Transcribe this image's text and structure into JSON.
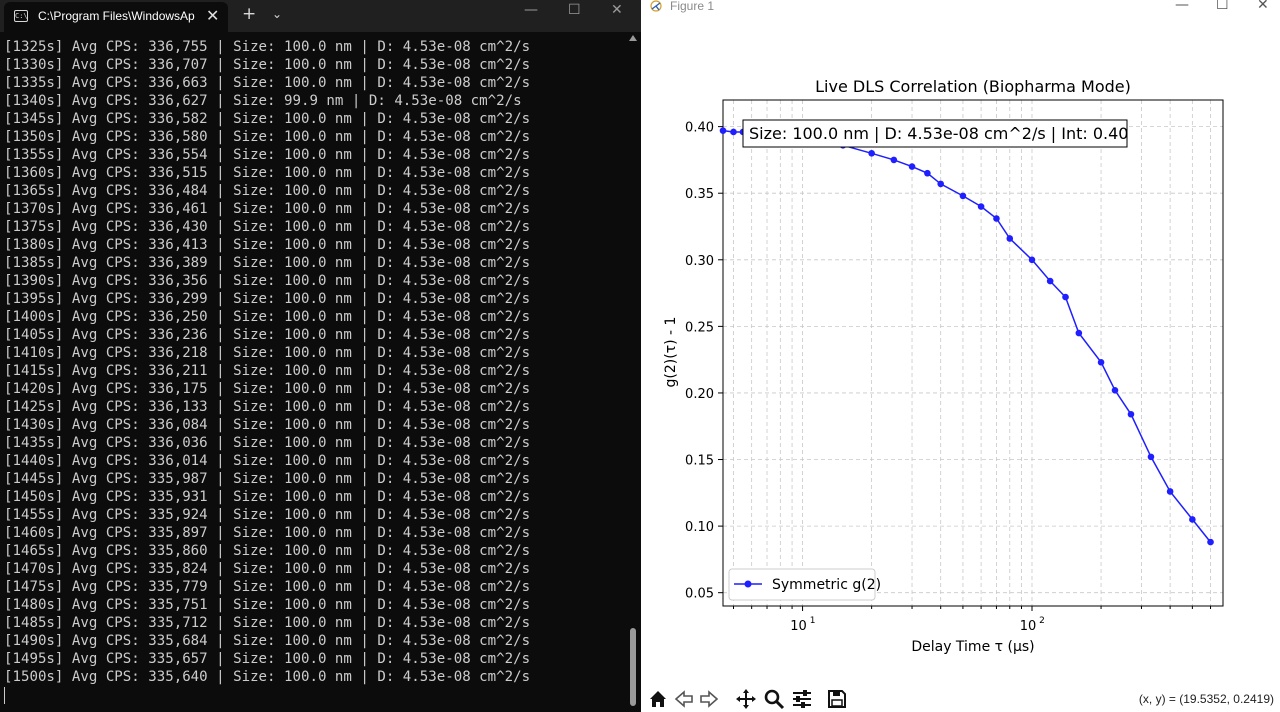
{
  "terminal": {
    "tab_title": "C:\\Program Files\\WindowsAp",
    "tab_icon_text": "C:\\",
    "lines": [
      "[1325s] Avg CPS: 336,755 | Size: 100.0 nm | D: 4.53e-08 cm^2/s",
      "[1330s] Avg CPS: 336,707 | Size: 100.0 nm | D: 4.53e-08 cm^2/s",
      "[1335s] Avg CPS: 336,663 | Size: 100.0 nm | D: 4.53e-08 cm^2/s",
      "[1340s] Avg CPS: 336,627 | Size: 99.9 nm | D: 4.53e-08 cm^2/s",
      "[1345s] Avg CPS: 336,582 | Size: 100.0 nm | D: 4.53e-08 cm^2/s",
      "[1350s] Avg CPS: 336,580 | Size: 100.0 nm | D: 4.53e-08 cm^2/s",
      "[1355s] Avg CPS: 336,554 | Size: 100.0 nm | D: 4.53e-08 cm^2/s",
      "[1360s] Avg CPS: 336,515 | Size: 100.0 nm | D: 4.53e-08 cm^2/s",
      "[1365s] Avg CPS: 336,484 | Size: 100.0 nm | D: 4.53e-08 cm^2/s",
      "[1370s] Avg CPS: 336,461 | Size: 100.0 nm | D: 4.53e-08 cm^2/s",
      "[1375s] Avg CPS: 336,430 | Size: 100.0 nm | D: 4.53e-08 cm^2/s",
      "[1380s] Avg CPS: 336,413 | Size: 100.0 nm | D: 4.53e-08 cm^2/s",
      "[1385s] Avg CPS: 336,389 | Size: 100.0 nm | D: 4.53e-08 cm^2/s",
      "[1390s] Avg CPS: 336,356 | Size: 100.0 nm | D: 4.53e-08 cm^2/s",
      "[1395s] Avg CPS: 336,299 | Size: 100.0 nm | D: 4.53e-08 cm^2/s",
      "[1400s] Avg CPS: 336,250 | Size: 100.0 nm | D: 4.53e-08 cm^2/s",
      "[1405s] Avg CPS: 336,236 | Size: 100.0 nm | D: 4.53e-08 cm^2/s",
      "[1410s] Avg CPS: 336,218 | Size: 100.0 nm | D: 4.53e-08 cm^2/s",
      "[1415s] Avg CPS: 336,211 | Size: 100.0 nm | D: 4.53e-08 cm^2/s",
      "[1420s] Avg CPS: 336,175 | Size: 100.0 nm | D: 4.53e-08 cm^2/s",
      "[1425s] Avg CPS: 336,133 | Size: 100.0 nm | D: 4.53e-08 cm^2/s",
      "[1430s] Avg CPS: 336,084 | Size: 100.0 nm | D: 4.53e-08 cm^2/s",
      "[1435s] Avg CPS: 336,036 | Size: 100.0 nm | D: 4.53e-08 cm^2/s",
      "[1440s] Avg CPS: 336,014 | Size: 100.0 nm | D: 4.53e-08 cm^2/s",
      "[1445s] Avg CPS: 335,987 | Size: 100.0 nm | D: 4.53e-08 cm^2/s",
      "[1450s] Avg CPS: 335,931 | Size: 100.0 nm | D: 4.53e-08 cm^2/s",
      "[1455s] Avg CPS: 335,924 | Size: 100.0 nm | D: 4.53e-08 cm^2/s",
      "[1460s] Avg CPS: 335,897 | Size: 100.0 nm | D: 4.53e-08 cm^2/s",
      "[1465s] Avg CPS: 335,860 | Size: 100.0 nm | D: 4.53e-08 cm^2/s",
      "[1470s] Avg CPS: 335,824 | Size: 100.0 nm | D: 4.53e-08 cm^2/s",
      "[1475s] Avg CPS: 335,779 | Size: 100.0 nm | D: 4.53e-08 cm^2/s",
      "[1480s] Avg CPS: 335,751 | Size: 100.0 nm | D: 4.53e-08 cm^2/s",
      "[1485s] Avg CPS: 335,712 | Size: 100.0 nm | D: 4.53e-08 cm^2/s",
      "[1490s] Avg CPS: 335,684 | Size: 100.0 nm | D: 4.53e-08 cm^2/s",
      "[1495s] Avg CPS: 335,657 | Size: 100.0 nm | D: 4.53e-08 cm^2/s",
      "[1500s] Avg CPS: 335,640 | Size: 100.0 nm | D: 4.53e-08 cm^2/s"
    ],
    "controls": {
      "close_tab": "✕",
      "new_tab": "+",
      "dropdown": "⌄",
      "minimize": "—",
      "maximize": "☐",
      "close": "✕"
    },
    "colors": {
      "background": "#0c0c0c",
      "text": "#cccccc",
      "titlebar": "#202020"
    }
  },
  "figure": {
    "window_title": "Figure 1",
    "controls": {
      "minimize": "—",
      "maximize": "☐",
      "close": "✕"
    },
    "toolbar": {
      "buttons": [
        "home-icon",
        "back-icon",
        "forward-icon",
        "pan-icon",
        "zoom-icon",
        "configure-subplots-icon",
        "save-icon"
      ],
      "coords_text": "(x, y) = (19.5352, 0.2419)"
    }
  },
  "chart_data": {
    "type": "line",
    "title": "Live DLS Correlation (Biopharma Mode)",
    "xlabel_text": "Delay Time τ (μs)",
    "ylabel_text": "g(2)(τ) - 1",
    "xscale": "log",
    "xlim": [
      4.5,
      680
    ],
    "ylim": [
      0.04,
      0.42
    ],
    "xticks": [
      {
        "base": "10",
        "exp": "1",
        "value": 10
      },
      {
        "base": "10",
        "exp": "2",
        "value": 100
      }
    ],
    "yticks": [
      0.05,
      0.1,
      0.15,
      0.2,
      0.25,
      0.3,
      0.35,
      0.4
    ],
    "ytick_labels": [
      "0.05",
      "0.10",
      "0.15",
      "0.20",
      "0.25",
      "0.30",
      "0.35",
      "0.40"
    ],
    "grid": true,
    "annotation": "Size: 100.0 nm | D: 4.53e-08 cm^2/s | Int: 0.40",
    "legend": {
      "label": "Symmetric g(2)",
      "position": "lower-left"
    },
    "series": [
      {
        "name": "Symmetric g(2)",
        "color": "#1f1fff",
        "points": [
          [
            4.5,
            0.397
          ],
          [
            5.0,
            0.396
          ],
          [
            5.5,
            0.396
          ],
          [
            6.0,
            0.396
          ],
          [
            6.5,
            0.395
          ],
          [
            7.0,
            0.395
          ],
          [
            7.5,
            0.394
          ],
          [
            8.0,
            0.394
          ],
          [
            10.0,
            0.392
          ],
          [
            12.5,
            0.389
          ],
          [
            15.0,
            0.386
          ],
          [
            20.0,
            0.38
          ],
          [
            25.0,
            0.375
          ],
          [
            30.0,
            0.37
          ],
          [
            35.0,
            0.365
          ],
          [
            40.0,
            0.357
          ],
          [
            50.0,
            0.348
          ],
          [
            60.0,
            0.34
          ],
          [
            70.0,
            0.331
          ],
          [
            80.0,
            0.316
          ],
          [
            100.0,
            0.3
          ],
          [
            120.0,
            0.284
          ],
          [
            140.0,
            0.272
          ],
          [
            160.0,
            0.245
          ],
          [
            200.0,
            0.223
          ],
          [
            230.0,
            0.202
          ],
          [
            270.0,
            0.184
          ],
          [
            330.0,
            0.152
          ],
          [
            400.0,
            0.126
          ],
          [
            500.0,
            0.105
          ],
          [
            600.0,
            0.088
          ]
        ]
      }
    ]
  }
}
